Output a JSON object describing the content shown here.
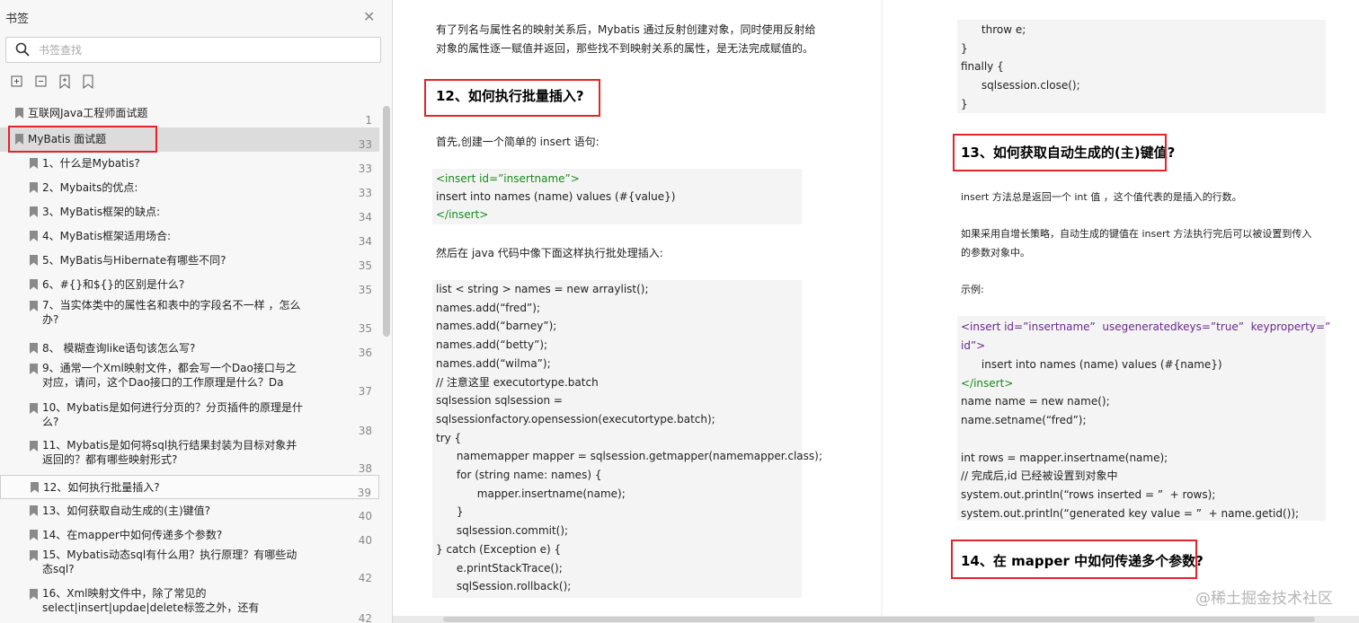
{
  "sidebar": {
    "title": "书签",
    "search_placeholder": "书签查找",
    "tools": [
      "expand-all-icon",
      "collapse-all-icon",
      "add-bookmark-icon",
      "bookmark-icon"
    ],
    "items": [
      {
        "label": "互联网Java工程师面试题",
        "page": "1"
      },
      {
        "label": "MyBatis 面试题",
        "page": "33"
      },
      {
        "label": "1、什么是Mybatis?",
        "page": "33"
      },
      {
        "label": "2、Mybaits的优点:",
        "page": "33"
      },
      {
        "label": "3、MyBatis框架的缺点:",
        "page": "34"
      },
      {
        "label": "4、MyBatis框架适用场合:",
        "page": "34"
      },
      {
        "label": "5、MyBatis与Hibernate有哪些不同?",
        "page": "35"
      },
      {
        "label": "6、#{}和${}的区别是什么?",
        "page": "35"
      },
      {
        "label": "7、当实体类中的属性名和表中的字段名不一样 ，怎么办?",
        "page": "35"
      },
      {
        "label": "8、 模糊查询like语句该怎么写?",
        "page": "36"
      },
      {
        "label": "9、通常一个Xml映射文件，都会写一个Dao接口与之对应，请问，这个Dao接口的工作原理是什么？Da",
        "page": "37"
      },
      {
        "label": "10、Mybatis是如何进行分页的？分页插件的原理是什么?",
        "page": "38"
      },
      {
        "label": "11、Mybatis是如何将sql执行结果封装为目标对象并返回的？都有哪些映射形式?",
        "page": "38"
      },
      {
        "label": "12、如何执行批量插入?",
        "page": "39"
      },
      {
        "label": "13、如何获取自动生成的(主)键值?",
        "page": "40"
      },
      {
        "label": "14、在mapper中如何传递多个参数?",
        "page": "40"
      },
      {
        "label": "15、Mybatis动态sql有什么用？执行原理？有哪些动态sql?",
        "page": "42"
      },
      {
        "label": "16、Xml映射文件中，除了常见的select|insert|updae|delete标签之外，还有",
        "page": "42"
      }
    ]
  },
  "page1": {
    "intro": [
      "有了列名与属性名的映射关系后，Mybatis 通过反射创建对象，同时使用反射给",
      "对象的属性逐一赋值并返回，那些找不到映射关系的属性，是无法完成赋值的。"
    ],
    "heading": "12、如何执行批量插入?",
    "p1": "首先,创建一个简单的 insert 语句:",
    "xml1": [
      "<insert id=”insertname”>",
      "insert into names (name) values (#{value})",
      "</insert>"
    ],
    "p2": "然后在 java 代码中像下面这样执行批处理插入:",
    "code": [
      "list < string > names = new arraylist();",
      "names.add(“fred”);",
      "names.add(“barney”);",
      "names.add(“betty”);",
      "names.add(“wilma”);",
      "// 注意这里 executortype.batch",
      "sqlsession sqlsession =",
      "sqlsessionfactory.opensession(executortype.batch);",
      "try {",
      "      namemapper mapper = sqlsession.getmapper(namemapper.class);",
      "      for (string name: names) {",
      "            mapper.insertname(name);",
      "      }",
      "      sqlsession.commit();",
      "} catch (Exception e) {",
      "      e.printStackTrace();",
      "      sqlSession.rollback();"
    ]
  },
  "page2": {
    "code_top": [
      "      throw e;",
      "}",
      "finally {",
      "      sqlsession.close();",
      "}"
    ],
    "heading13": "13、如何获取自动生成的(主)键值?",
    "p1": "insert 方法总是返回一个 int 值 ，这个值代表的是插入的行数。",
    "p2": [
      "如果采用自增长策略，自动生成的键值在  insert 方法执行完后可以被设置到传入",
      "的参数对象中。"
    ],
    "p3": "示例:",
    "xml_open": "<insert id=”insertname”  usegeneratedkeys=”true”  keyproperty=”",
    "xml_open2": "id”>",
    "code": [
      "      insert into names (name) values (#{name})",
      "</insert>",
      "name name = new name();",
      "name.setname(“fred”);",
      "",
      "int rows = mapper.insertname(name);",
      "// 完成后,id 已经被设置到对象中",
      "system.out.println(“rows inserted = ”  + rows);",
      "system.out.println(“generated key value = ”  + name.getid());"
    ],
    "heading14": "14、在 mapper 中如何传递多个参数?"
  },
  "watermark": "@稀土掘金技术社区"
}
